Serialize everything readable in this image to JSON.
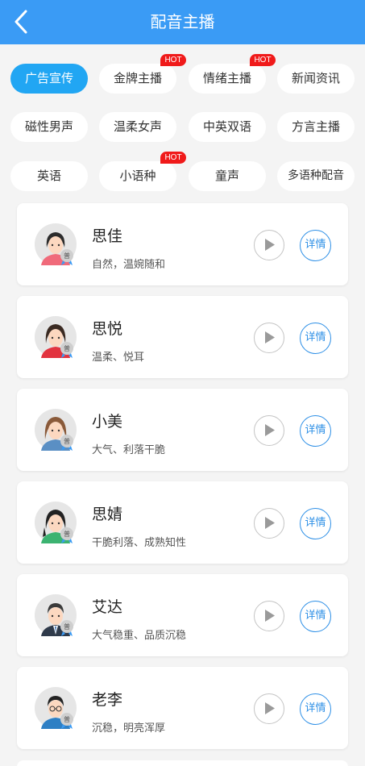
{
  "header": {
    "title": "配音主播"
  },
  "tags": [
    {
      "label": "广告宣传",
      "hot": ""
    },
    {
      "label": "金牌主播",
      "hot": "HOT"
    },
    {
      "label": "情绪主播",
      "hot": "HOT"
    },
    {
      "label": "新闻资讯",
      "hot": ""
    },
    {
      "label": "磁性男声",
      "hot": ""
    },
    {
      "label": "温柔女声",
      "hot": ""
    },
    {
      "label": "中英双语",
      "hot": ""
    },
    {
      "label": "方言主播",
      "hot": ""
    },
    {
      "label": "英语",
      "hot": ""
    },
    {
      "label": "小语种",
      "hot": "HOT"
    },
    {
      "label": "童声",
      "hot": ""
    },
    {
      "label": "多语种配音",
      "hot": ""
    }
  ],
  "anchors": [
    {
      "name": "思佳",
      "desc": "自然，温婉随和",
      "badge": "普",
      "detail": "详情"
    },
    {
      "name": "思悦",
      "desc": "温柔、悦耳",
      "badge": "普",
      "detail": "详情"
    },
    {
      "name": "小美",
      "desc": "大气、利落干脆",
      "badge": "普",
      "detail": "详情"
    },
    {
      "name": "思婧",
      "desc": "干脆利落、成熟知性",
      "badge": "普",
      "detail": "详情"
    },
    {
      "name": "艾达",
      "desc": "大气稳重、品质沉稳",
      "badge": "普",
      "detail": "详情"
    },
    {
      "name": "老李",
      "desc": "沉稳，明亮浑厚",
      "badge": "普",
      "detail": "详情"
    }
  ],
  "colors": {
    "header_bg": "#3a9bf5",
    "active_tag": "#21a6f3",
    "hot_badge": "#f01a1a",
    "detail_accent": "#2d8fe6"
  }
}
